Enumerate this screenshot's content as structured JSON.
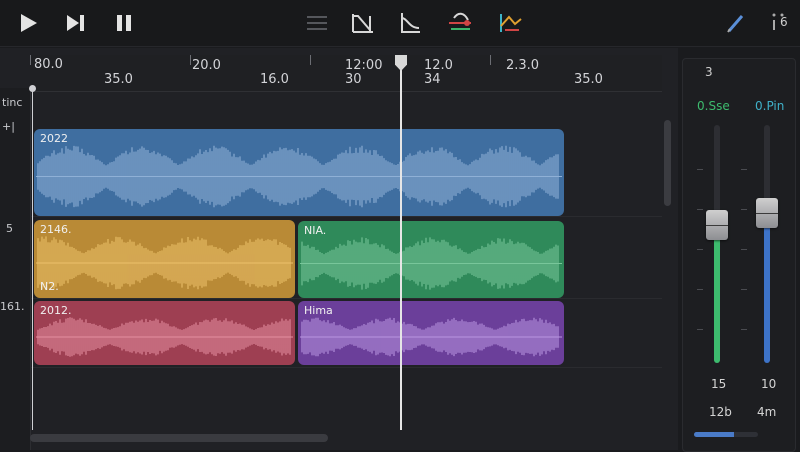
{
  "toolbar": {
    "buttons": [
      {
        "name": "play-button",
        "icon": "play-icon"
      },
      {
        "name": "skip-forward-button",
        "icon": "skip-forward-icon"
      },
      {
        "name": "pause-button",
        "icon": "pause-icon"
      },
      {
        "name": "menu-button",
        "icon": "menu-lines-icon"
      },
      {
        "name": "automation-tool-button",
        "icon": "automation-icon"
      },
      {
        "name": "envelope-tool-button",
        "icon": "envelope-icon"
      },
      {
        "name": "mix-tool-button",
        "icon": "mix-icon"
      },
      {
        "name": "curve-tool-button",
        "icon": "curve-icon"
      },
      {
        "name": "pencil-button",
        "icon": "pencil-icon"
      },
      {
        "name": "settings-button",
        "icon": "settings-icon"
      }
    ],
    "settings_label": "6"
  },
  "ruler": {
    "labels": [
      "80.0",
      "35.0",
      "20.0",
      "16.0",
      "12:00",
      "30",
      "12.0",
      "34",
      "2.3.0",
      "35.0"
    ]
  },
  "track_headers": [
    "tinc",
    "+|",
    "5",
    "161."
  ],
  "clips": [
    {
      "label": "2022",
      "color": "#3f6ea0",
      "wave": "#8fb0d6"
    },
    {
      "label": "2146.",
      "sublabel": "N2.",
      "color": "#b98a36",
      "wave": "#ecc06a"
    },
    {
      "label": "NIA.",
      "color": "#2f8a5a",
      "wave": "#78c69a"
    },
    {
      "label": "2012.",
      "color": "#9e3f52",
      "wave": "#e48ea0"
    },
    {
      "label": "Hima",
      "color": "#6b3f9a",
      "wave": "#b995e0"
    }
  ],
  "mixer": {
    "title": "3",
    "channels": [
      {
        "name": "0.Sse",
        "value": "15",
        "sub": "12b",
        "color": "#3dbb6e",
        "level": 0.58
      },
      {
        "name": "0.Pin",
        "value": "10",
        "sub": "4m",
        "color": "#3d73c8",
        "level": 0.63
      }
    ],
    "meter_level": 0.63
  },
  "playhead_time": "12:00"
}
